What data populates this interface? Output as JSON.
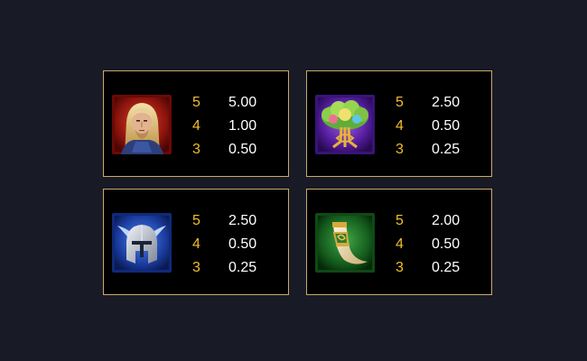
{
  "paytable": {
    "cards": [
      {
        "symbol": "thor-portrait-icon",
        "frame_color": "#b2281a",
        "rows": [
          {
            "count": "5",
            "value": "5.00"
          },
          {
            "count": "4",
            "value": "1.00"
          },
          {
            "count": "3",
            "value": "0.50"
          }
        ]
      },
      {
        "symbol": "yggdrasil-tree-icon",
        "frame_color": "#7a2fd0",
        "rows": [
          {
            "count": "5",
            "value": "2.50"
          },
          {
            "count": "4",
            "value": "0.50"
          },
          {
            "count": "3",
            "value": "0.25"
          }
        ]
      },
      {
        "symbol": "winged-helmet-icon",
        "frame_color": "#2a55c8",
        "rows": [
          {
            "count": "5",
            "value": "2.50"
          },
          {
            "count": "4",
            "value": "0.50"
          },
          {
            "count": "3",
            "value": "0.25"
          }
        ]
      },
      {
        "symbol": "drinking-horn-icon",
        "frame_color": "#1f8a2a",
        "rows": [
          {
            "count": "5",
            "value": "2.00"
          },
          {
            "count": "4",
            "value": "0.50"
          },
          {
            "count": "3",
            "value": "0.25"
          }
        ]
      }
    ]
  }
}
